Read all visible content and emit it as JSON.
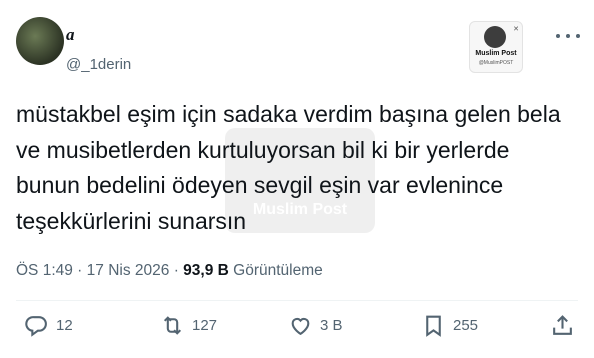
{
  "author": {
    "display_name": "a",
    "handle": "@_1derin"
  },
  "badge": {
    "brand": "Muslim Post",
    "sub": "@MuslimPOST",
    "watermark": "Muslim Post"
  },
  "tweet": {
    "text": "müstakbel eşim için sadaka verdim başına gelen bela ve musibetlerden kurtuluyorsan bil ki bir yerlerde bunun bedelini ödeyen sevgil eşin var evlenince teşekkürlerini sunarsın"
  },
  "meta": {
    "time": "ÖS 1:49",
    "sep1": " · ",
    "date": "17 Nis 2026",
    "sep2": " · ",
    "views_count": "93,9 B",
    "views_label": " Görüntüleme"
  },
  "actions": {
    "replies": "12",
    "reposts": "127",
    "likes": "3 B",
    "bookmarks": "255"
  },
  "icons": {
    "reply": "speech-bubble",
    "repost": "retweet-arrows",
    "like": "heart",
    "bookmark": "bookmark",
    "share": "upload-arrow",
    "more": "three-dots"
  }
}
